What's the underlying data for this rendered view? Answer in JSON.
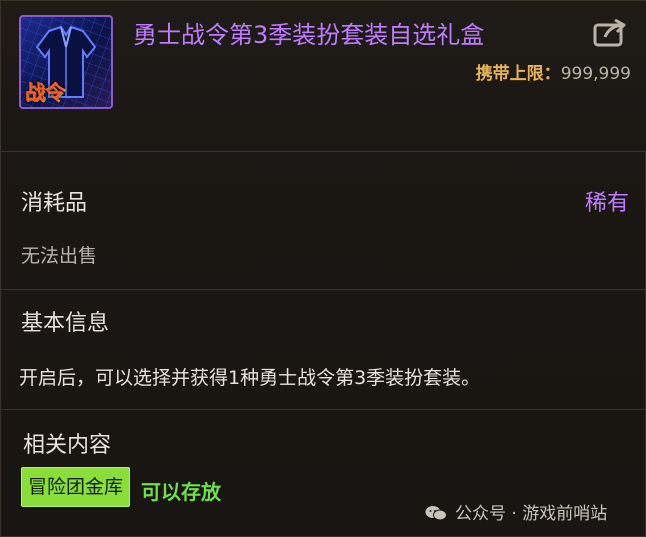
{
  "item": {
    "title": "勇士战令第3季装扮套装自选礼盒",
    "icon_badge": "战令",
    "icon": "armor-outfit-icon",
    "carry_label": "携带上限：",
    "carry_value": "999,999",
    "share_icon": "share-external-icon"
  },
  "info": {
    "category": "消耗品",
    "rarity": "稀有",
    "sell_status": "无法出售",
    "basic_title": "基本信息",
    "description": "开启后，可以选择并获得1种勇士战令第3季装扮套装。",
    "related_title": "相关内容",
    "tag_button": "冒险团金库",
    "storage_status": "可以存放"
  },
  "watermark": {
    "text": "公众号 · 游戏前哨站",
    "icon": "wechat-icon"
  },
  "colors": {
    "title_purple": "#c07cff",
    "carry_gold": "#e8b454",
    "tag_green": "#8bde3a",
    "store_green": "#6ee04a"
  }
}
